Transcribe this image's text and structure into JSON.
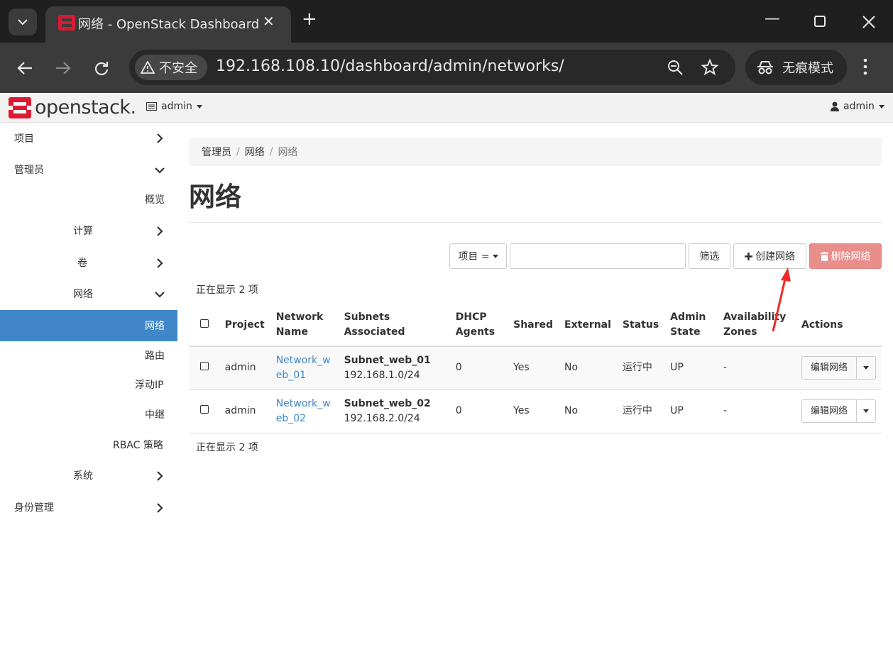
{
  "browser": {
    "tab_title": "网络 - OpenStack Dashboard",
    "security_label": "不安全",
    "url": "192.168.108.10/dashboard/admin/networks/",
    "incognito_label": "无痕模式"
  },
  "header": {
    "logo_text": "openstack.",
    "project_selector": "admin",
    "user_menu": "admin"
  },
  "sidebar": {
    "items": [
      {
        "label": "项目"
      },
      {
        "label": "管理员"
      },
      {
        "label": "概览"
      },
      {
        "label": "计算"
      },
      {
        "label": "卷"
      },
      {
        "label": "网络"
      },
      {
        "label": "网络"
      },
      {
        "label": "路由"
      },
      {
        "label": "浮动IP"
      },
      {
        "label": "中继"
      },
      {
        "label": "RBAC 策略"
      },
      {
        "label": "系统"
      },
      {
        "label": "身份管理"
      }
    ]
  },
  "breadcrumb": {
    "items": [
      "管理员",
      "网络",
      "网络"
    ]
  },
  "page_title": "网络",
  "toolbar": {
    "filter_select": "项目 =",
    "filter_button": "筛选",
    "create_button": "创建网络",
    "delete_button": "删除网络"
  },
  "count_text": "正在显示 2 项",
  "table": {
    "headers": {
      "project": "Project",
      "network_name_1": "Network",
      "network_name_2": "Name",
      "subnets": "Subnets Associated",
      "dhcp_1": "DHCP",
      "dhcp_2": "Agents",
      "shared": "Shared",
      "external": "External",
      "status": "Status",
      "admin_state_1": "Admin",
      "admin_state_2": "State",
      "az_1": "Availability",
      "az_2": "Zones",
      "actions": "Actions"
    },
    "rows": [
      {
        "project": "admin",
        "name_1": "Network_w",
        "name_2": "eb_01",
        "subnet_name": "Subnet_web_01",
        "subnet_cidr": "192.168.1.0/24",
        "dhcp": "0",
        "shared": "Yes",
        "external": "No",
        "status": "运行中",
        "admin_state": "UP",
        "az": "-",
        "action": "编辑网络"
      },
      {
        "project": "admin",
        "name_1": "Network_w",
        "name_2": "eb_02",
        "subnet_name": "Subnet_web_02",
        "subnet_cidr": "192.168.2.0/24",
        "dhcp": "0",
        "shared": "Yes",
        "external": "No",
        "status": "运行中",
        "admin_state": "UP",
        "az": "-",
        "action": "编辑网络"
      }
    ]
  },
  "colors": {
    "accent": "#3f87c8",
    "danger": "#e88e8b",
    "brand_red": "#da1a32",
    "annotation": "#ee2a24"
  }
}
